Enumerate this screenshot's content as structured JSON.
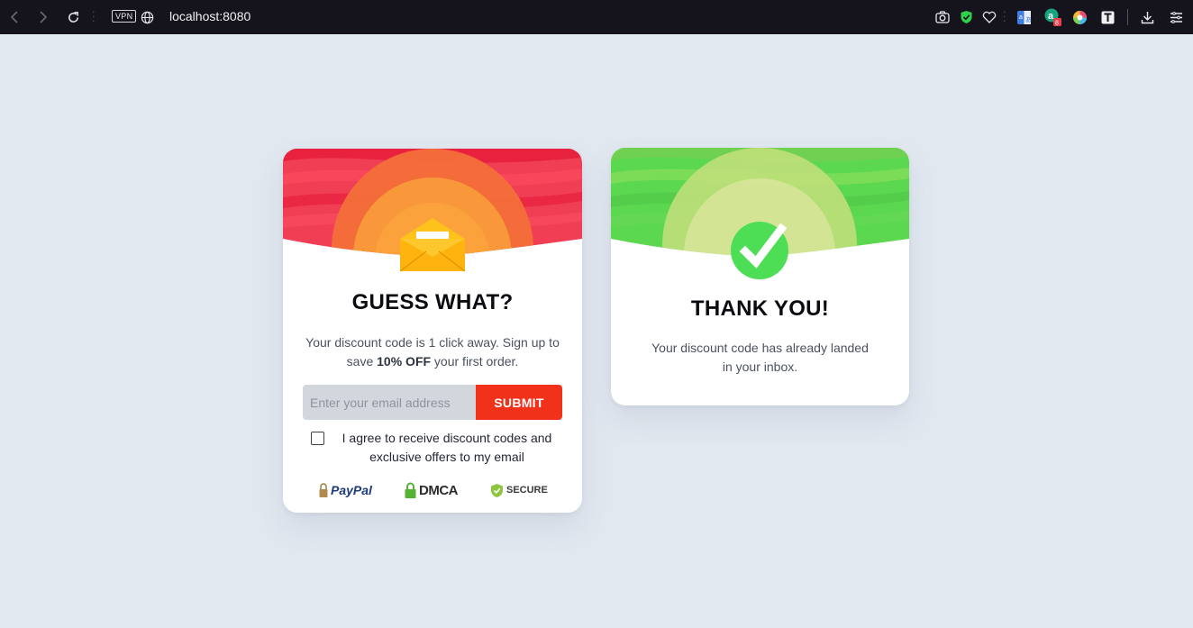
{
  "browser": {
    "url": "localhost:8080",
    "vpn_label": "VPN"
  },
  "optin_card": {
    "title": "GUESS WHAT?",
    "description_pre": "Your discount code is 1 click away. Sign up to save ",
    "description_bold": "10% OFF",
    "description_post": " your first order.",
    "email_placeholder": "Enter your email address",
    "submit_label": "SUBMIT",
    "agree_text": "I agree to receive discount codes and exclusive offers to my email",
    "badges": {
      "paypal": "PayPal",
      "dmca": "DMCA",
      "secure": "SECURE"
    }
  },
  "thanks_card": {
    "title": "THANK YOU!",
    "description": "Your discount code has already landed in your inbox."
  },
  "colors": {
    "background": "#e2e8f0",
    "submit": "#f2311a",
    "red_header": "#ef2a4a",
    "green_header": "#5cdd52"
  }
}
